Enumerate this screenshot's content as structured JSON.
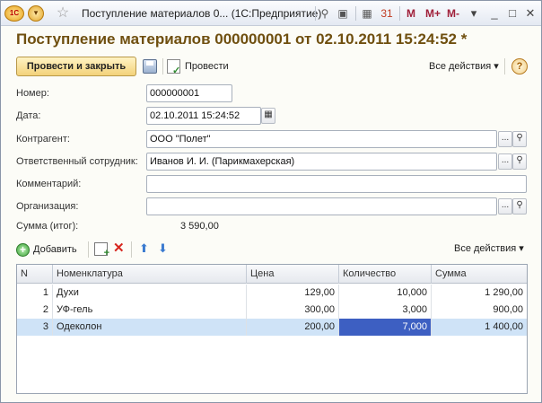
{
  "window": {
    "logo": "1С",
    "title": "Поступление материалов 0... (1С:Предприятие)",
    "memory_buttons": [
      "M",
      "M+",
      "M-"
    ],
    "menu_arrow": "▾"
  },
  "document": {
    "title": "Поступление материалов 000000001 от 02.10.2011 15:24:52 *"
  },
  "command_bar": {
    "post_and_close": "Провести и закрыть",
    "post": "Провести",
    "all_actions": "Все действия ▾",
    "help": "?"
  },
  "form": {
    "number_label": "Номер:",
    "number_value": "000000001",
    "date_label": "Дата:",
    "date_value": "02.10.2011 15:24:52",
    "counterparty_label": "Контрагент:",
    "counterparty_value": "ООО \"Полет\"",
    "employee_label": "Ответственный сотрудник:",
    "employee_value": "Иванов И. И. (Парикмахерская)",
    "comment_label": "Комментарий:",
    "comment_value": "",
    "organization_label": "Организация:",
    "organization_value": "",
    "total_label": "Сумма (итог):",
    "total_value": "3 590,00",
    "select_glyph": "...",
    "open_glyph": "🔍"
  },
  "table_toolbar": {
    "add": "Добавить",
    "all_actions": "Все действия ▾"
  },
  "table": {
    "columns": [
      "N",
      "Номенклатура",
      "Цена",
      "Количество",
      "Сумма"
    ],
    "rows": [
      {
        "n": "1",
        "item": "Духи",
        "price": "129,00",
        "qty": "10,000",
        "sum": "1 290,00"
      },
      {
        "n": "2",
        "item": "УФ-гель",
        "price": "300,00",
        "qty": "3,000",
        "sum": "900,00"
      },
      {
        "n": "3",
        "item": "Одеколон",
        "price": "200,00",
        "qty": "7,000",
        "sum": "1 400,00"
      }
    ],
    "selected_row": 3
  },
  "colors": {
    "title_brown": "#6f4f0f",
    "selection_row": "#cfe3f7",
    "selection_cell": "#3d5fc2",
    "primary_button": "#f3d27a"
  }
}
